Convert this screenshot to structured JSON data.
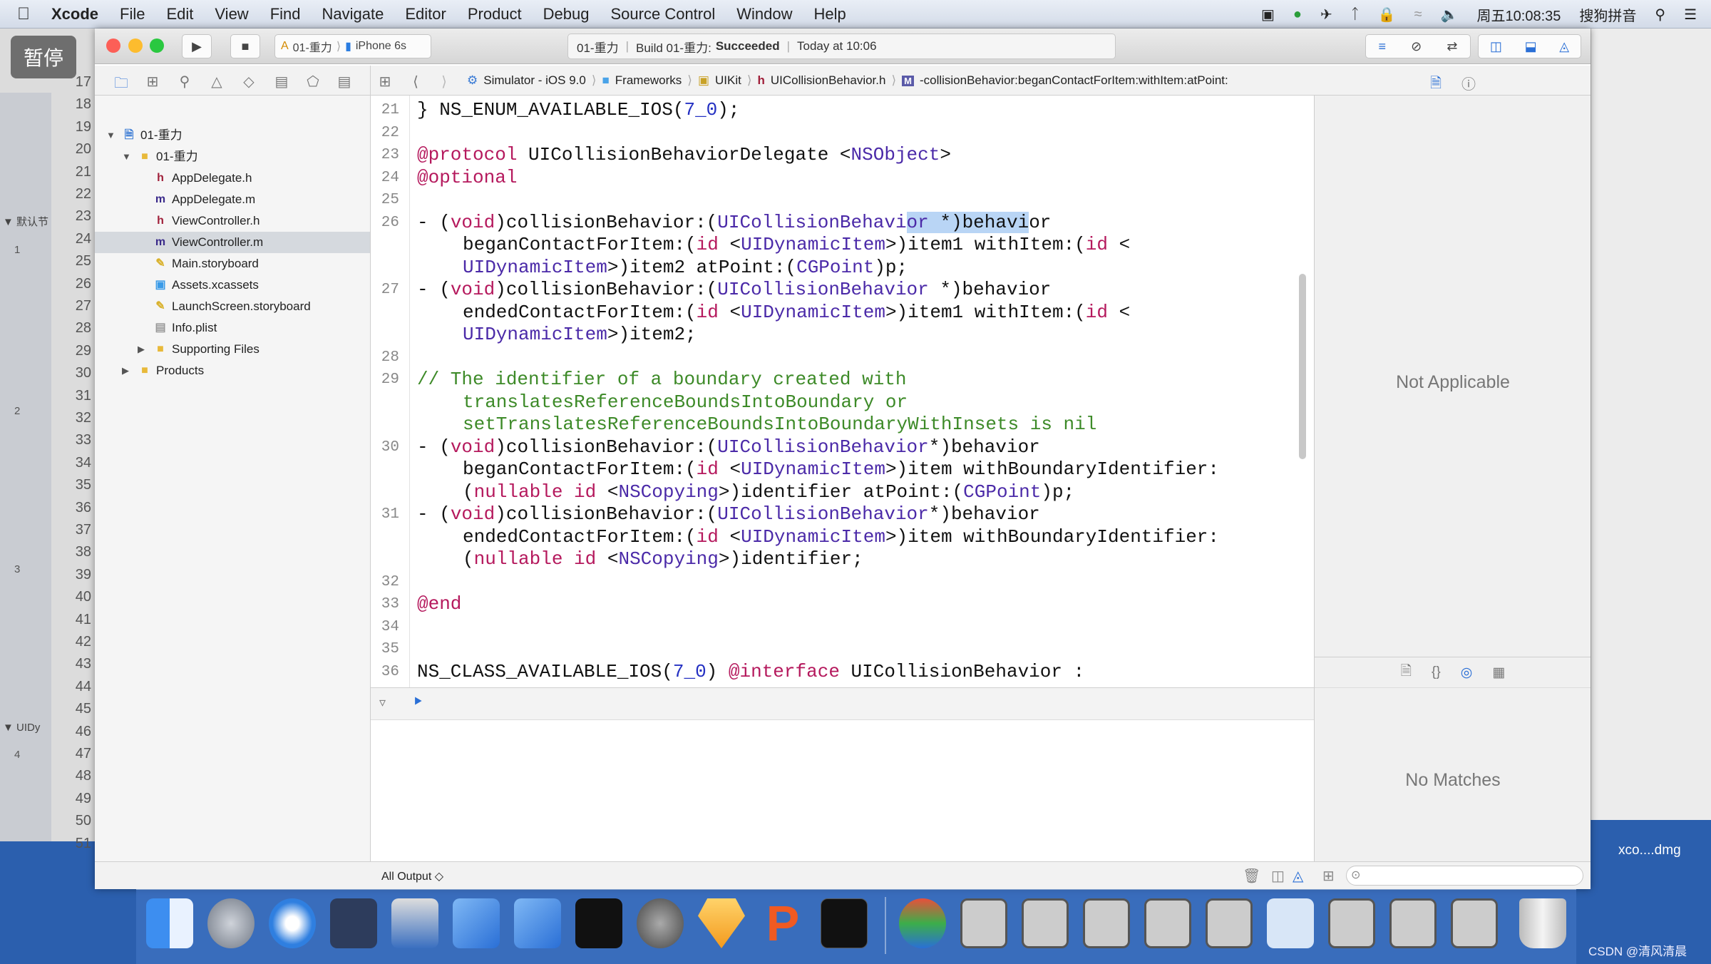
{
  "menubar": {
    "items": [
      "Xcode",
      "File",
      "Edit",
      "View",
      "Find",
      "Navigate",
      "Editor",
      "Product",
      "Debug",
      "Source Control",
      "Window",
      "Help"
    ],
    "clock": "周五10:08:35",
    "input_method": "搜狗拼音"
  },
  "overlay": {
    "pause_label": "暂停"
  },
  "background_window": {
    "line_numbers": [
      "17",
      "18",
      "19",
      "20",
      "21",
      "22",
      "23",
      "24",
      "25",
      "26",
      "27",
      "28",
      "29",
      "30",
      "31",
      "32",
      "33",
      "34",
      "35",
      "36",
      "37",
      "38",
      "39",
      "40",
      "41",
      "42",
      "43",
      "44",
      "45",
      "46",
      "47",
      "48",
      "49",
      "50",
      "51"
    ],
    "section1": "▼ 默认节",
    "section2": "▼ UIDy",
    "row_numbers": [
      "1",
      "2",
      "3",
      "4"
    ]
  },
  "toolbar": {
    "scheme": "01-重力",
    "device": "iPhone 6s",
    "activity_project": "01-重力",
    "activity_build": "Build 01-重力:",
    "activity_status": "Succeeded",
    "activity_time": "Today at 10:06"
  },
  "jumpbar": {
    "crumbs": [
      "Simulator - iOS 9.0",
      "Frameworks",
      "UIKit",
      "UICollisionBehavior.h",
      "-collisionBehavior:beganContactForItem:withItem:atPoint:"
    ]
  },
  "navigator": {
    "items": [
      {
        "label": "01-重力",
        "depth": 0,
        "disclosure": "▼",
        "icon": "project",
        "selected": false
      },
      {
        "label": "01-重力",
        "depth": 1,
        "disclosure": "▼",
        "icon": "folder",
        "selected": false
      },
      {
        "label": "AppDelegate.h",
        "depth": 2,
        "icon": "h",
        "selected": false
      },
      {
        "label": "AppDelegate.m",
        "depth": 2,
        "icon": "m",
        "selected": false
      },
      {
        "label": "ViewController.h",
        "depth": 2,
        "icon": "h",
        "selected": false
      },
      {
        "label": "ViewController.m",
        "depth": 2,
        "icon": "m",
        "selected": true
      },
      {
        "label": "Main.storyboard",
        "depth": 2,
        "icon": "storyboard",
        "selected": false
      },
      {
        "label": "Assets.xcassets",
        "depth": 2,
        "icon": "assets",
        "selected": false
      },
      {
        "label": "LaunchScreen.storyboard",
        "depth": 2,
        "icon": "storyboard",
        "selected": false
      },
      {
        "label": "Info.plist",
        "depth": 2,
        "icon": "plist",
        "selected": false
      },
      {
        "label": "Supporting Files",
        "depth": 2,
        "disclosure": "▶",
        "icon": "folder",
        "selected": false
      },
      {
        "label": "Products",
        "depth": 1,
        "disclosure": "▶",
        "icon": "folder",
        "selected": false
      }
    ]
  },
  "editor": {
    "lines": [
      {
        "n": "21",
        "t": [
          [
            "} NS_ENUM_AVAILABLE_IOS(",
            ""
          ],
          [
            "7_0",
            "n"
          ],
          [
            ");",
            ""
          ]
        ]
      },
      {
        "n": "22",
        "t": []
      },
      {
        "n": "23",
        "t": [
          [
            "@protocol",
            "k"
          ],
          [
            " UICollisionBehaviorDelegate <",
            ""
          ],
          [
            "NSObject",
            "t"
          ],
          [
            ">",
            ""
          ]
        ]
      },
      {
        "n": "24",
        "t": [
          [
            "@optional",
            "k"
          ]
        ]
      },
      {
        "n": "25",
        "t": []
      },
      {
        "n": "26",
        "t": [
          [
            "- (",
            ""
          ],
          [
            "void",
            "k"
          ],
          [
            ")collisionBehavior:(",
            ""
          ],
          [
            "UICollisionBehavi",
            "t"
          ],
          [
            "or",
            "t s"
          ],
          [
            " *)behavi",
            "s"
          ],
          [
            "or",
            ""
          ]
        ]
      },
      {
        "n": "",
        "cont": true,
        "t": [
          [
            "beganContactForItem:(",
            ""
          ],
          [
            "id",
            "k"
          ],
          [
            " <",
            ""
          ],
          [
            "UIDynamicItem",
            "t"
          ],
          [
            ">)item1 withItem:(",
            ""
          ],
          [
            "id",
            "k"
          ],
          [
            " <",
            ""
          ]
        ]
      },
      {
        "n": "",
        "cont": true,
        "t": [
          [
            "UIDynamicItem",
            "t"
          ],
          [
            ">)item2 atPoint:(",
            ""
          ],
          [
            "CGPoint",
            "t"
          ],
          [
            ")p;",
            ""
          ]
        ]
      },
      {
        "n": "27",
        "t": [
          [
            "- (",
            ""
          ],
          [
            "void",
            "k"
          ],
          [
            ")collisionBehavior:(",
            ""
          ],
          [
            "UICollisionBehavior",
            "t"
          ],
          [
            " *)behavior",
            ""
          ]
        ]
      },
      {
        "n": "",
        "cont": true,
        "t": [
          [
            "endedContactForItem:(",
            ""
          ],
          [
            "id",
            "k"
          ],
          [
            " <",
            ""
          ],
          [
            "UIDynamicItem",
            "t"
          ],
          [
            ">)item1 withItem:(",
            ""
          ],
          [
            "id",
            "k"
          ],
          [
            " <",
            ""
          ]
        ]
      },
      {
        "n": "",
        "cont": true,
        "t": [
          [
            "UIDynamicItem",
            "t"
          ],
          [
            ">)item2;",
            ""
          ]
        ]
      },
      {
        "n": "28",
        "t": []
      },
      {
        "n": "29",
        "t": [
          [
            "// The identifier of a boundary created with",
            "c"
          ]
        ]
      },
      {
        "n": "",
        "cont": true,
        "t": [
          [
            "translatesReferenceBoundsIntoBoundary or",
            "c"
          ]
        ]
      },
      {
        "n": "",
        "cont": true,
        "t": [
          [
            "setTranslatesReferenceBoundsIntoBoundaryWithInsets is nil",
            "c"
          ]
        ]
      },
      {
        "n": "30",
        "t": [
          [
            "- (",
            ""
          ],
          [
            "void",
            "k"
          ],
          [
            ")collisionBehavior:(",
            ""
          ],
          [
            "UICollisionBehavior",
            "t"
          ],
          [
            "*)behavior",
            ""
          ]
        ]
      },
      {
        "n": "",
        "cont": true,
        "t": [
          [
            "beganContactForItem:(",
            ""
          ],
          [
            "id",
            "k"
          ],
          [
            " <",
            ""
          ],
          [
            "UIDynamicItem",
            "t"
          ],
          [
            ">)item withBoundaryIdentifier:",
            ""
          ]
        ]
      },
      {
        "n": "",
        "cont": true,
        "t": [
          [
            "(",
            ""
          ],
          [
            "nullable id",
            "k"
          ],
          [
            " <",
            ""
          ],
          [
            "NSCopying",
            "t"
          ],
          [
            ">)identifier atPoint:(",
            ""
          ],
          [
            "CGPoint",
            "t"
          ],
          [
            ")p;",
            ""
          ]
        ]
      },
      {
        "n": "31",
        "t": [
          [
            "- (",
            ""
          ],
          [
            "void",
            "k"
          ],
          [
            ")collisionBehavior:(",
            ""
          ],
          [
            "UICollisionBehavior",
            "t"
          ],
          [
            "*)behavior",
            ""
          ]
        ]
      },
      {
        "n": "",
        "cont": true,
        "t": [
          [
            "endedContactForItem:(",
            ""
          ],
          [
            "id",
            "k"
          ],
          [
            " <",
            ""
          ],
          [
            "UIDynamicItem",
            "t"
          ],
          [
            ">)item withBoundaryIdentifier:",
            ""
          ]
        ]
      },
      {
        "n": "",
        "cont": true,
        "t": [
          [
            "(",
            ""
          ],
          [
            "nullable id",
            "k"
          ],
          [
            " <",
            ""
          ],
          [
            "NSCopying",
            "t"
          ],
          [
            ">)identifier;",
            ""
          ]
        ]
      },
      {
        "n": "32",
        "t": []
      },
      {
        "n": "33",
        "t": [
          [
            "@end",
            "k"
          ]
        ]
      },
      {
        "n": "34",
        "t": []
      },
      {
        "n": "35",
        "t": []
      },
      {
        "n": "36",
        "t": [
          [
            "NS_CLASS_AVAILABLE_IOS(",
            ""
          ],
          [
            "7_0",
            "n"
          ],
          [
            ") ",
            ""
          ],
          [
            "@interface",
            "k"
          ],
          [
            " UICollisionBehavior :",
            ""
          ]
        ]
      }
    ]
  },
  "console": {
    "output_selector": "All Output ◇"
  },
  "inspector": {
    "file_inspector_message": "Not Applicable",
    "library_message": "No Matches"
  },
  "desktop": {
    "file_label": "xco....dmg",
    "watermark": "CSDN @清风清晨"
  },
  "colors": {
    "keyword": "#b5195d",
    "type": "#4b2aa8",
    "number": "#2430c2",
    "comment": "#3d8a28",
    "selection": "#b9d5f5",
    "desktop": "#2b5fae"
  }
}
